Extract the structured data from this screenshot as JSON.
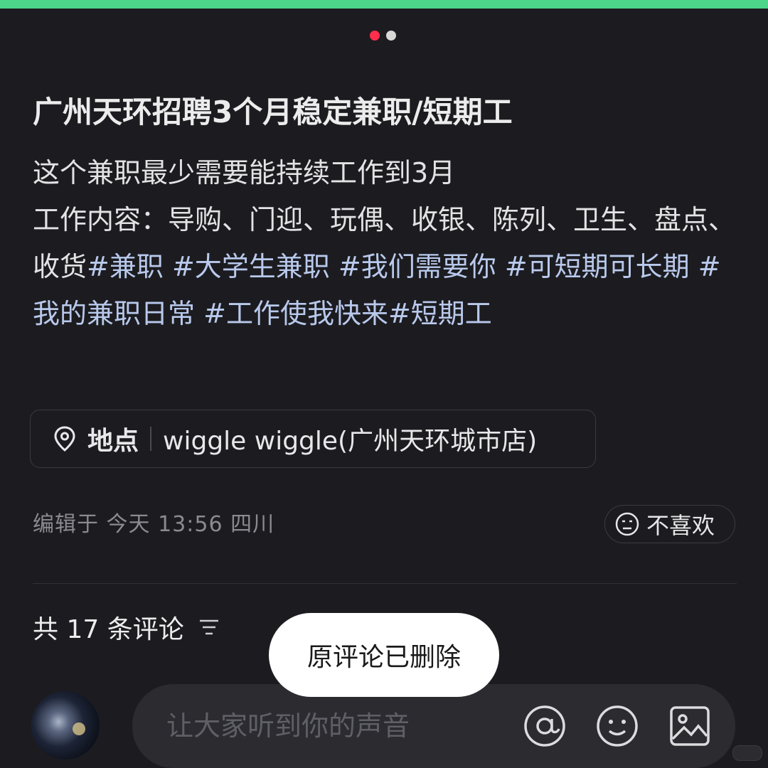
{
  "post": {
    "title": "广州天环招聘3个月稳定兼职/短期工",
    "body_line1": "这个兼职最少需要能持续工作到3月",
    "body_line2": "工作内容：导购、门迎、玩偶、收银、陈列、卫生、盘点、收货",
    "tags": [
      "#兼职",
      "#大学生兼职",
      "#我们需要你",
      "#可短期可长期",
      "#我的兼职日常",
      "#工作使我快来",
      "#短期工"
    ]
  },
  "location": {
    "label": "地点",
    "value": "wiggle wiggle(广州天环城市店)"
  },
  "meta": {
    "edited": "编辑于 今天 13:56 四川",
    "dislike_label": "不喜欢"
  },
  "comments": {
    "header": "共 17 条评论"
  },
  "toast": {
    "message": "原评论已删除"
  },
  "input": {
    "placeholder": "让大家听到你的声音"
  },
  "carousel": {
    "current": 1,
    "total": 2
  },
  "icons": {
    "location": "location-pin-icon",
    "dislike": "frown-face-icon",
    "filter": "filter-icon",
    "mention": "at-sign-icon",
    "emoji": "smile-face-icon",
    "image": "image-icon"
  },
  "colors": {
    "accent_top": "#4cd68a",
    "dot_active": "#ff2e4d",
    "tag": "#b9c9ec",
    "background": "#1c1c20"
  }
}
